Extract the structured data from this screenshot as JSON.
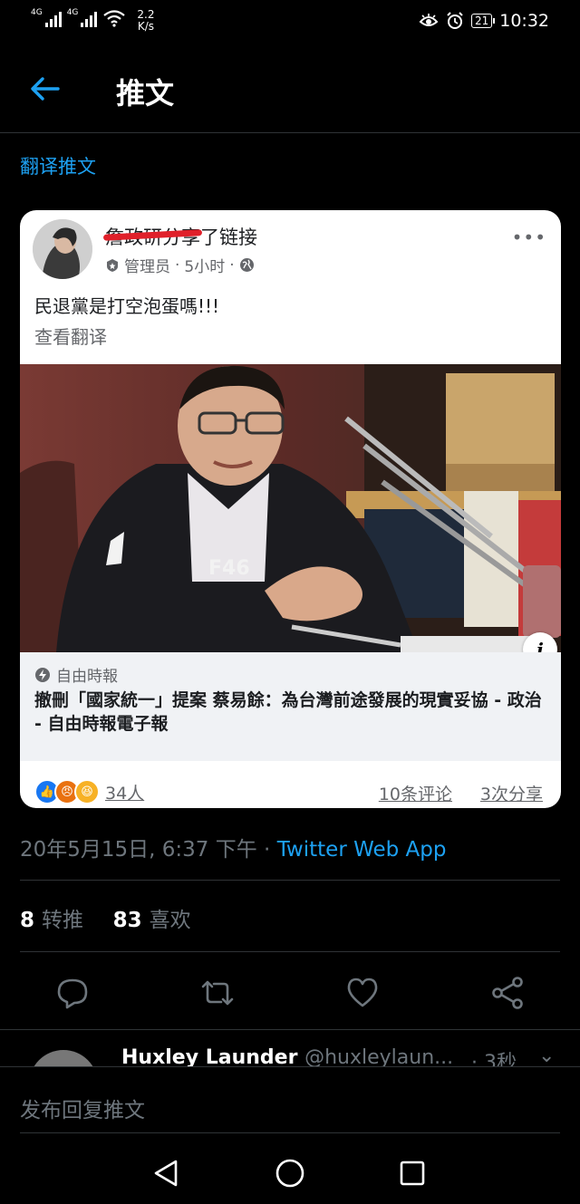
{
  "status_bar": {
    "sim1": "4G",
    "sim2": "4G",
    "speed_value": "2.2",
    "speed_unit": "K/s",
    "battery": "21",
    "time": "10:32"
  },
  "header": {
    "title": "推文",
    "translate_link": "翻译推文"
  },
  "card": {
    "page_name": "詹政研分享",
    "action": "了链接",
    "role": "管理员",
    "time_ago": "5小时",
    "post_text": "民退黨是打空泡蛋嗎!!!",
    "see_translation": "查看翻译",
    "link_source": "自由時報",
    "link_title": "撤刪「國家統一」提案 蔡易餘：為台灣前途發展的現實妥協 - 政治 - 自由時報電子報",
    "reactions_count": "34人",
    "comments": "10条评论",
    "shares": "3次分享"
  },
  "tweet": {
    "timestamp": "20年5月15日, 6:37 下午",
    "separator": " · ",
    "source_app": "Twitter Web App",
    "retweets_count": "8",
    "retweets_label": "转推",
    "likes_count": "83",
    "likes_label": "喜欢"
  },
  "reply_preview": {
    "name": "Huxley Launder",
    "handle": "@huxleylaun...",
    "time": "· 3秒"
  },
  "compose": {
    "placeholder": "发布回复推文"
  },
  "colors": {
    "accent": "#1da1f2",
    "muted": "#6e767d",
    "divider": "#2f3336"
  }
}
